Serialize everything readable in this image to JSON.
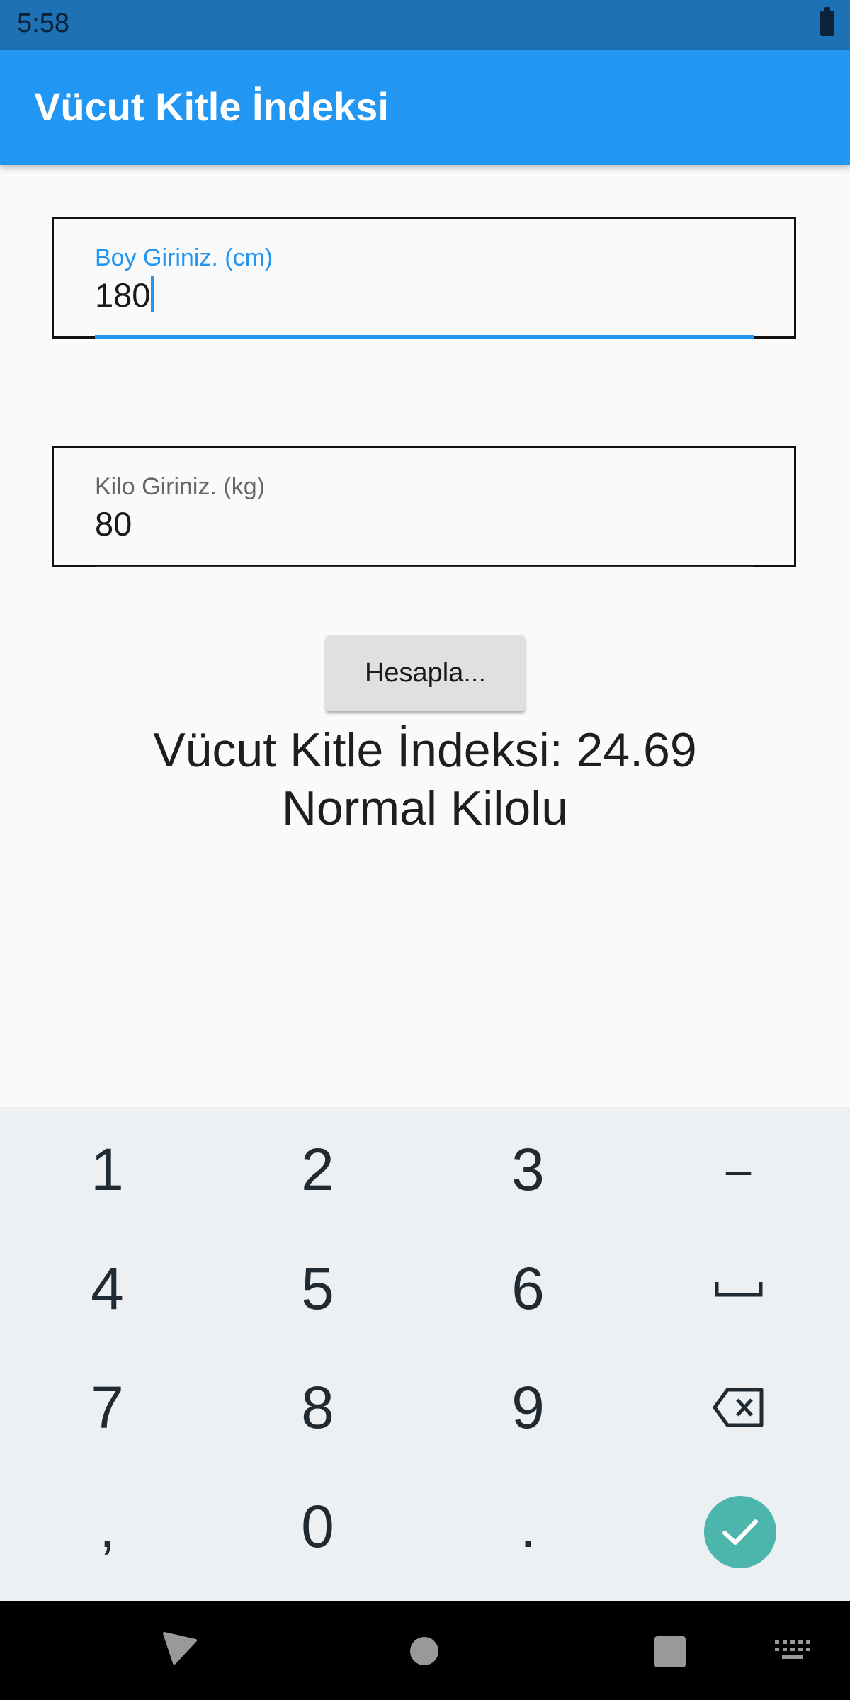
{
  "status_bar": {
    "time": "5:58"
  },
  "app_bar": {
    "title": "Vücut Kitle İndeksi"
  },
  "height_field": {
    "label": "Boy Giriniz. (cm)",
    "value": "180"
  },
  "weight_field": {
    "label": "Kilo Giriniz. (kg)",
    "value": "80"
  },
  "calculate_button": {
    "label": "Hesapla..."
  },
  "result": {
    "bmi_line": "Vücut Kitle İndeksi: 24.69",
    "category": "Normal Kilolu"
  },
  "keyboard": {
    "keys": [
      "1",
      "2",
      "3",
      "–",
      "4",
      "5",
      "6",
      "␣",
      "7",
      "8",
      "9",
      "⌫",
      ",",
      "0",
      ".",
      "✓"
    ]
  },
  "colors": {
    "primary": "#2196f3",
    "status_bar": "#1c72b5",
    "done_key": "#4db6ac",
    "keyboard_bg": "#edf0f3"
  }
}
